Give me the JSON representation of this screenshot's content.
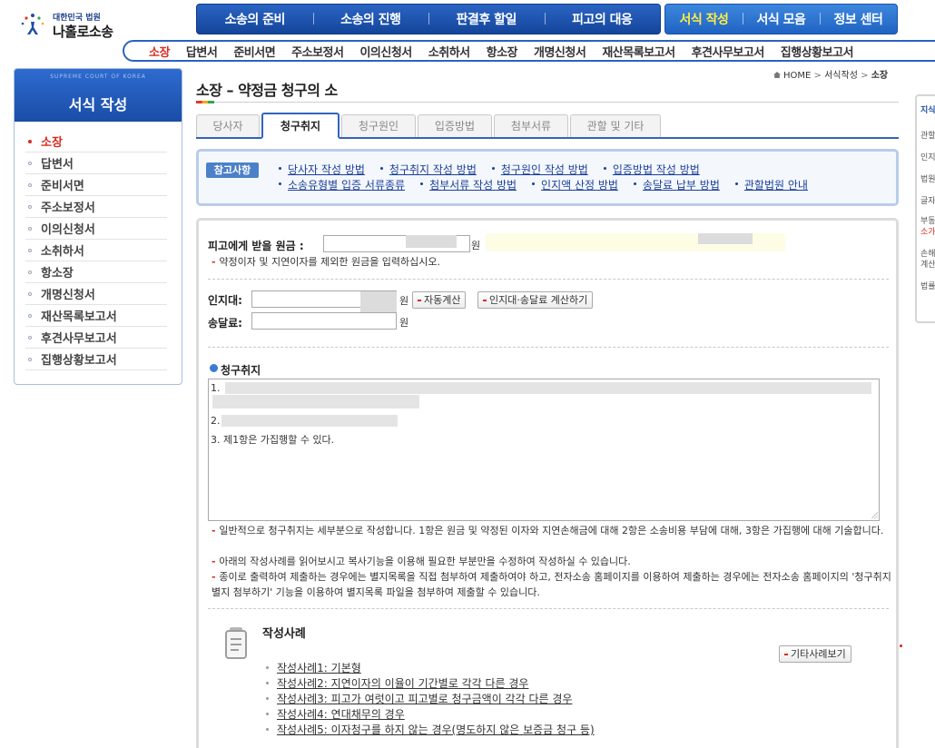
{
  "logo": {
    "org": "대한민국 법원",
    "name": "나홀로소송"
  },
  "gnb": {
    "main": [
      "소송의 준비",
      "소송의 진행",
      "판결후 할일",
      "피고의 대응"
    ],
    "side": [
      "서식 작성",
      "서식 모음",
      "정보 센터"
    ]
  },
  "subnav": [
    "소장",
    "답변서",
    "준비서면",
    "주소보정서",
    "이의신청서",
    "소취하서",
    "항소장",
    "개명신청서",
    "재산목록보고서",
    "후견사무보고서",
    "집행상황보고서"
  ],
  "lnb": {
    "sub": "SUPREME COURT OF KOREA",
    "title": "서식 작성",
    "items": [
      "소장",
      "답변서",
      "준비서면",
      "주소보정서",
      "이의신청서",
      "소취하서",
      "항소장",
      "개명신청서",
      "재산목록보고서",
      "후견사무보고서",
      "집행상황보고서"
    ]
  },
  "breadcrumb": {
    "home": "HOME",
    "sep": ">",
    "level1": "서식작성",
    "current": "소장"
  },
  "page": {
    "title": "소장 – 약정금 청구의 소"
  },
  "tabs": [
    "당사자",
    "청구취지",
    "청구원인",
    "입증방법",
    "첨부서류",
    "관할 및 기타"
  ],
  "reference": {
    "badge": "참고사항",
    "row1": [
      "당사자 작성 방법",
      "청구취지 작성 방법",
      "청구원인 작성 방법",
      "입증방법 작성 방법"
    ],
    "row2": [
      "소송유형별 입증 서류종류",
      "첨부서류 작성 방법",
      "인지액 산정 방법",
      "송달료 납부 방법",
      "관할법원 안내"
    ]
  },
  "form": {
    "principal_label": "피고에게 받을 원금 :",
    "principal_unit": "원",
    "principal_hint": "약정이자 및 지연이자를 제외한 원금을 입력하십시오.",
    "stamp_label": "인지대:",
    "stamp_unit": "원",
    "delivery_label": "송달료:",
    "delivery_unit": "원",
    "auto_calc_button": "자동계산",
    "calc_button": "인지대·송달료 계산하기",
    "claim_title": "청구취지",
    "claim_lines": [
      "1.",
      "2.",
      "3. 제1항은 가집행할 수 있다."
    ],
    "hints": [
      "일반적으로 청구취지는 세부분으로 작성합니다. 1항은 원금 및 약정된 이자와 지연손해금에 대해 2항은 소송비용 부담에 대해, 3항은 가집행에 대해 기술합니다.",
      "아래의 작성사례를 읽어보시고 복사기능을 이용해 필요한 부분만을 수정하여 작성하실 수 있습니다.",
      "종이로 출력하여 제출하는 경우에는 별지목록을 직접 첨부하여 제출하여야 하고, 전자소송 홈페이지를 이용하여 제출하는 경우에는 전자소송 홈페이지의 '청구취지별지 첨부하기' 기능을 이용하여 별지목록 파일을 첨부하여 제출할 수 있습니다."
    ]
  },
  "examples": {
    "title": "작성사례",
    "other_button": "기타사례보기",
    "items": [
      "작성사례1: 기본형",
      "작성사례2: 지연이자의 이율이 기간별로 각각 다른 경우",
      "작성사례3: 피고가 여럿이고 피고별로 청구금액이 각각 다른 경우",
      "작성사례4: 연대채무의 경우",
      "작성사례5: 이자청구를 하지 않는 경우(명도하지 않은 보증금 청구 등)"
    ]
  },
  "right_panel": [
    "지식",
    "관할",
    "인지",
    "법원",
    "글자",
    "부동",
    "소가",
    "손해",
    "계산",
    "법률"
  ],
  "colors": {
    "brand": "#1d4fa8",
    "accent": "#d92b1f",
    "highlight": "#ffee44"
  }
}
